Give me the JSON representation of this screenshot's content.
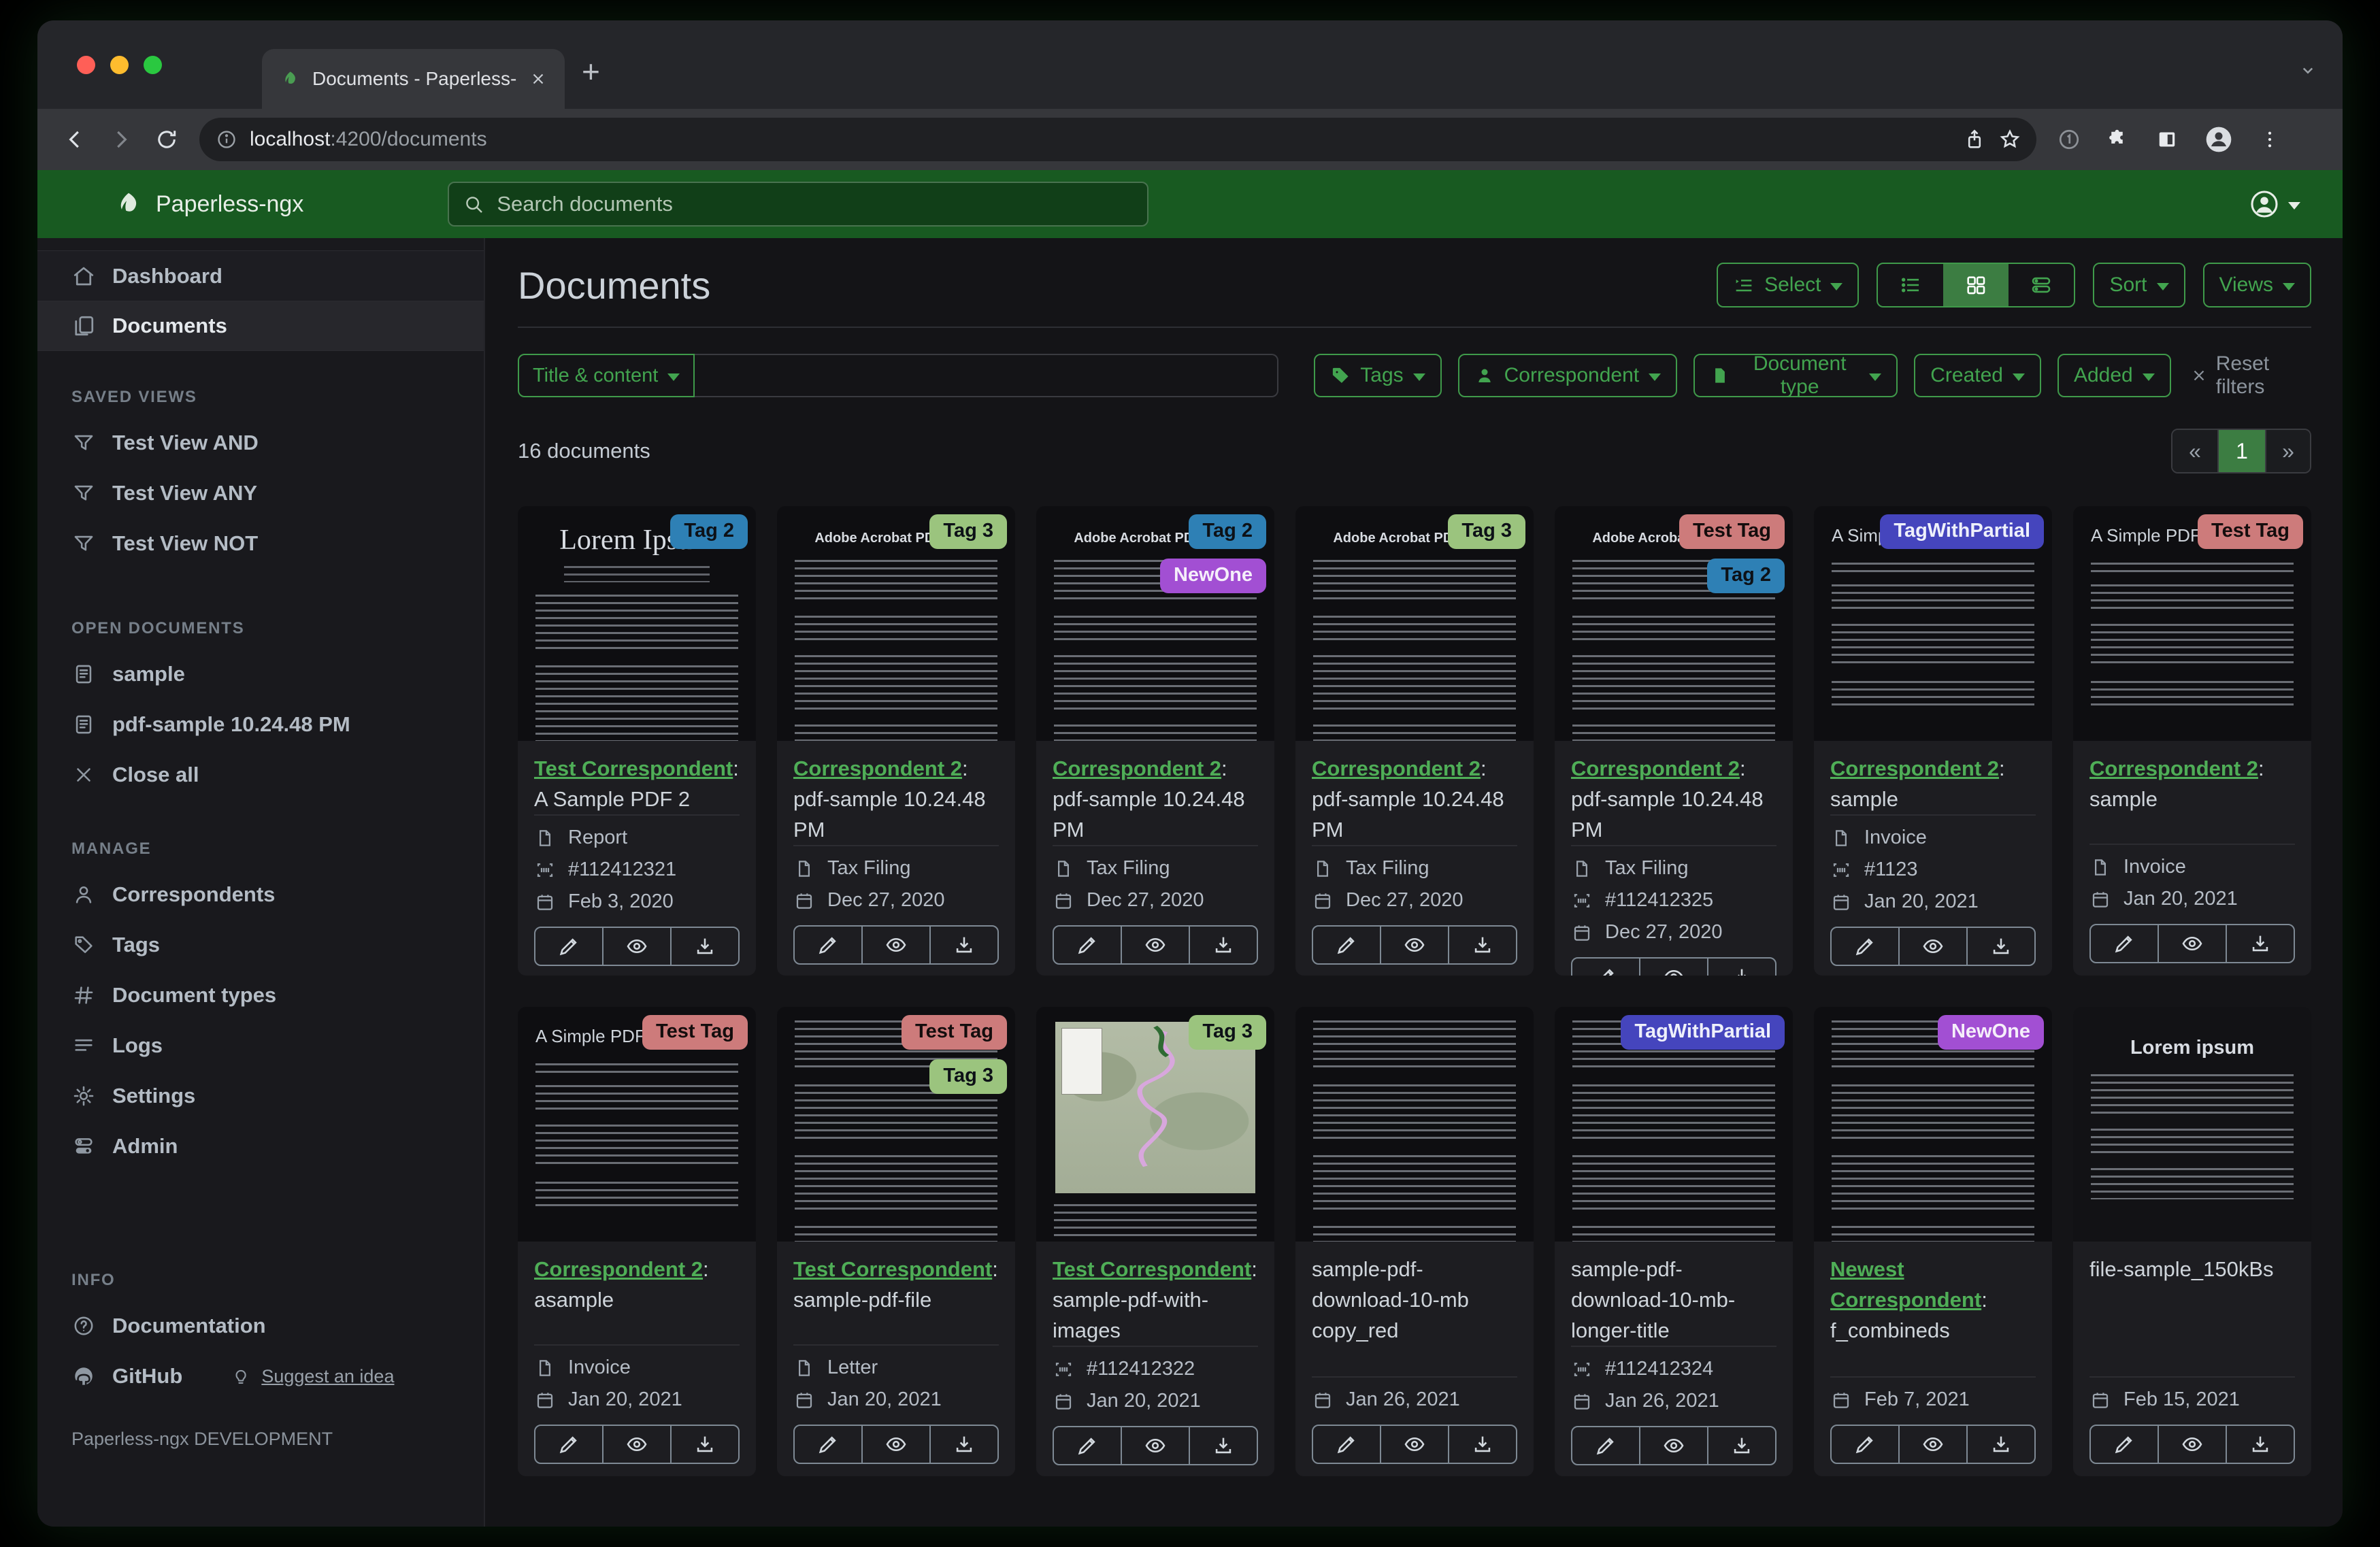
{
  "browser": {
    "tab_title": "Documents - Paperless-ngx",
    "url_host": "localhost",
    "url_path": ":4200/documents",
    "new_tab_glyph": "+"
  },
  "app_header": {
    "brand": "Paperless-ngx",
    "search_placeholder": "Search documents"
  },
  "sidebar": {
    "top": [
      {
        "label": "Dashboard",
        "icon": "home",
        "active": false
      },
      {
        "label": "Documents",
        "icon": "copy",
        "active": true
      }
    ],
    "sections": [
      {
        "heading": "SAVED VIEWS",
        "cls": "saved",
        "items": [
          {
            "label": "Test View AND",
            "icon": "funnel"
          },
          {
            "label": "Test View ANY",
            "icon": "funnel"
          },
          {
            "label": "Test View NOT",
            "icon": "funnel"
          }
        ]
      },
      {
        "heading": "OPEN DOCUMENTS",
        "cls": "open-docs",
        "items": [
          {
            "label": "sample",
            "icon": "doc"
          },
          {
            "label": "pdf-sample 10.24.48 PM",
            "icon": "doc"
          },
          {
            "label": "Close all",
            "icon": "x"
          }
        ]
      },
      {
        "heading": "MANAGE",
        "cls": "manage",
        "items": [
          {
            "label": "Correspondents",
            "icon": "person"
          },
          {
            "label": "Tags",
            "icon": "tag"
          },
          {
            "label": "Document types",
            "icon": "hash"
          },
          {
            "label": "Logs",
            "icon": "lines"
          },
          {
            "label": "Settings",
            "icon": "gear"
          },
          {
            "label": "Admin",
            "icon": "toggles"
          }
        ]
      },
      {
        "heading": "INFO",
        "cls": "info",
        "items": [
          {
            "label": "Documentation",
            "icon": "question"
          },
          {
            "label": "GitHub",
            "icon": "github",
            "extra": {
              "label": "Suggest an idea",
              "icon": "bulb"
            }
          }
        ]
      }
    ],
    "footer": "Paperless-ngx DEVELOPMENT"
  },
  "main": {
    "title": "Documents",
    "select_label": "Select",
    "sort_label": "Sort",
    "views_label": "Views"
  },
  "filters": {
    "field_label": "Title & content",
    "tags_label": "Tags",
    "correspondent_label": "Correspondent",
    "document_type_label": "Document type",
    "created_label": "Created",
    "added_label": "Added",
    "reset_label": "Reset filters"
  },
  "results": {
    "count": "16 documents",
    "prev": "«",
    "page": "1",
    "next": "»"
  },
  "colors": {
    "header_green": "#185a21",
    "accent_green": "#3f9a4a",
    "active_segment_green": "#3c7d42",
    "link_green": "#4fae57"
  },
  "icons": {
    "traffic_close": "#ff5f57",
    "traffic_min": "#febc2e",
    "traffic_max": "#2ac840",
    "used": [
      "leaf-icon",
      "search-icon",
      "home-icon",
      "copy-icon",
      "funnel-icon",
      "doc-icon",
      "close-icon",
      "person-icon",
      "tag-icon",
      "hash-icon",
      "lines-icon",
      "gear-icon",
      "toggles-icon",
      "question-icon",
      "github-icon",
      "bulb-icon",
      "file-icon",
      "barcode-icon",
      "calendar-icon",
      "pencil-icon",
      "eye-icon",
      "download-icon",
      "list-view-icon",
      "grid-view-icon",
      "detail-view-icon",
      "select-icon",
      "info-icon",
      "back-icon",
      "forward-icon",
      "reload-icon",
      "share-icon",
      "star-icon",
      "extension-icon",
      "puzzle-icon",
      "panel-icon",
      "avatar-icon",
      "menu-dots-icon",
      "chevron-down-icon"
    ]
  },
  "tag_styles": {
    "Tag 2": {
      "bg": "#2e80b5",
      "fg": "#0d1117"
    },
    "Tag 3": {
      "bg": "#9bc47e",
      "fg": "#0d1117"
    },
    "NewOne": {
      "bg": "#a24fd3",
      "fg": "#f5eefa"
    },
    "Test Tag": {
      "bg": "#cd7b7b",
      "fg": "#140d0d"
    },
    "TagWithPartial": {
      "bg": "#4545bd",
      "fg": "#eef0fb"
    }
  },
  "cards": [
    {
      "correspondent": "Test Correspondent",
      "title": "A Sample PDF 2",
      "doc_type": "Report",
      "asn": "#112412321",
      "date": "Feb 3, 2020",
      "tags": [
        "Tag 2"
      ],
      "thumb": {
        "kind": "lorem-serif",
        "heading": "Lorem Ipsum"
      }
    },
    {
      "correspondent": "Correspondent 2",
      "title": "pdf-sample 10.24.48 PM",
      "doc_type": "Tax Filing",
      "asn": null,
      "date": "Dec 27, 2020",
      "tags": [
        "Tag 3"
      ],
      "thumb": {
        "kind": "acrobat",
        "heading": "Adobe Acrobat PDF Files"
      }
    },
    {
      "correspondent": "Correspondent 2",
      "title": "pdf-sample 10.24.48 PM",
      "doc_type": "Tax Filing",
      "asn": null,
      "date": "Dec 27, 2020",
      "tags": [
        "Tag 2",
        "NewOne"
      ],
      "thumb": {
        "kind": "acrobat",
        "heading": "Adobe Acrobat PDF Files"
      }
    },
    {
      "correspondent": "Correspondent 2",
      "title": "pdf-sample 10.24.48 PM",
      "doc_type": "Tax Filing",
      "asn": null,
      "date": "Dec 27, 2020",
      "tags": [
        "Tag 3"
      ],
      "thumb": {
        "kind": "acrobat",
        "heading": "Adobe Acrobat PDF Files"
      }
    },
    {
      "correspondent": "Correspondent 2",
      "title": "pdf-sample 10.24.48 PM",
      "doc_type": "Tax Filing",
      "asn": "#112412325",
      "date": "Dec 27, 2020",
      "tags": [
        "Test Tag",
        "Tag 2"
      ],
      "thumb": {
        "kind": "acrobat",
        "heading": "Adobe Acrobat PDF Files"
      }
    },
    {
      "correspondent": "Correspondent 2",
      "title": "sample",
      "doc_type": "Invoice",
      "asn": "#1123",
      "date": "Jan 20, 2021",
      "tags": [
        "TagWithPartial"
      ],
      "thumb": {
        "kind": "simple",
        "heading": "A Simple PDF File"
      }
    },
    {
      "correspondent": "Correspondent 2",
      "title": "sample",
      "doc_type": "Invoice",
      "asn": null,
      "date": "Jan 20, 2021",
      "tags": [
        "Test Tag"
      ],
      "thumb": {
        "kind": "simple",
        "heading": "A Simple PDF File"
      }
    },
    {
      "correspondent": "Correspondent 2",
      "title": "asample",
      "doc_type": "Invoice",
      "asn": null,
      "date": "Jan 20, 2021",
      "tags": [
        "Test Tag"
      ],
      "thumb": {
        "kind": "simple",
        "heading": "A Simple PDF File"
      }
    },
    {
      "correspondent": "Test Correspondent",
      "title": "sample-pdf-file",
      "doc_type": "Letter",
      "asn": null,
      "date": "Jan 20, 2021",
      "tags": [
        "Test Tag",
        "Tag 3"
      ],
      "thumb": {
        "kind": "text-dense",
        "heading": ""
      }
    },
    {
      "correspondent": "Test Correspondent",
      "title": "sample-pdf-with-images",
      "doc_type": null,
      "asn": "#112412322",
      "date": "Jan 20, 2021",
      "tags": [
        "Tag 3"
      ],
      "thumb": {
        "kind": "map",
        "heading": ""
      }
    },
    {
      "correspondent": null,
      "title": "sample-pdf-download-10-mb copy_red",
      "doc_type": null,
      "asn": null,
      "date": "Jan 26, 2021",
      "tags": [],
      "thumb": {
        "kind": "text-dense",
        "heading": ""
      }
    },
    {
      "correspondent": null,
      "title": "sample-pdf-download-10-mb-longer-title",
      "doc_type": null,
      "asn": "#112412324",
      "date": "Jan 26, 2021",
      "tags": [
        "TagWithPartial"
      ],
      "thumb": {
        "kind": "text-dense",
        "heading": ""
      }
    },
    {
      "correspondent": "Newest Correspondent",
      "title": "f_combineds",
      "doc_type": null,
      "asn": null,
      "date": "Feb 7, 2021",
      "tags": [
        "NewOne"
      ],
      "thumb": {
        "kind": "text-dense",
        "heading": ""
      }
    },
    {
      "correspondent": null,
      "title": "file-sample_150kBs",
      "doc_type": null,
      "asn": null,
      "date": "Feb 15, 2021",
      "tags": [],
      "thumb": {
        "kind": "lorem-center",
        "heading": "Lorem ipsum"
      }
    }
  ]
}
